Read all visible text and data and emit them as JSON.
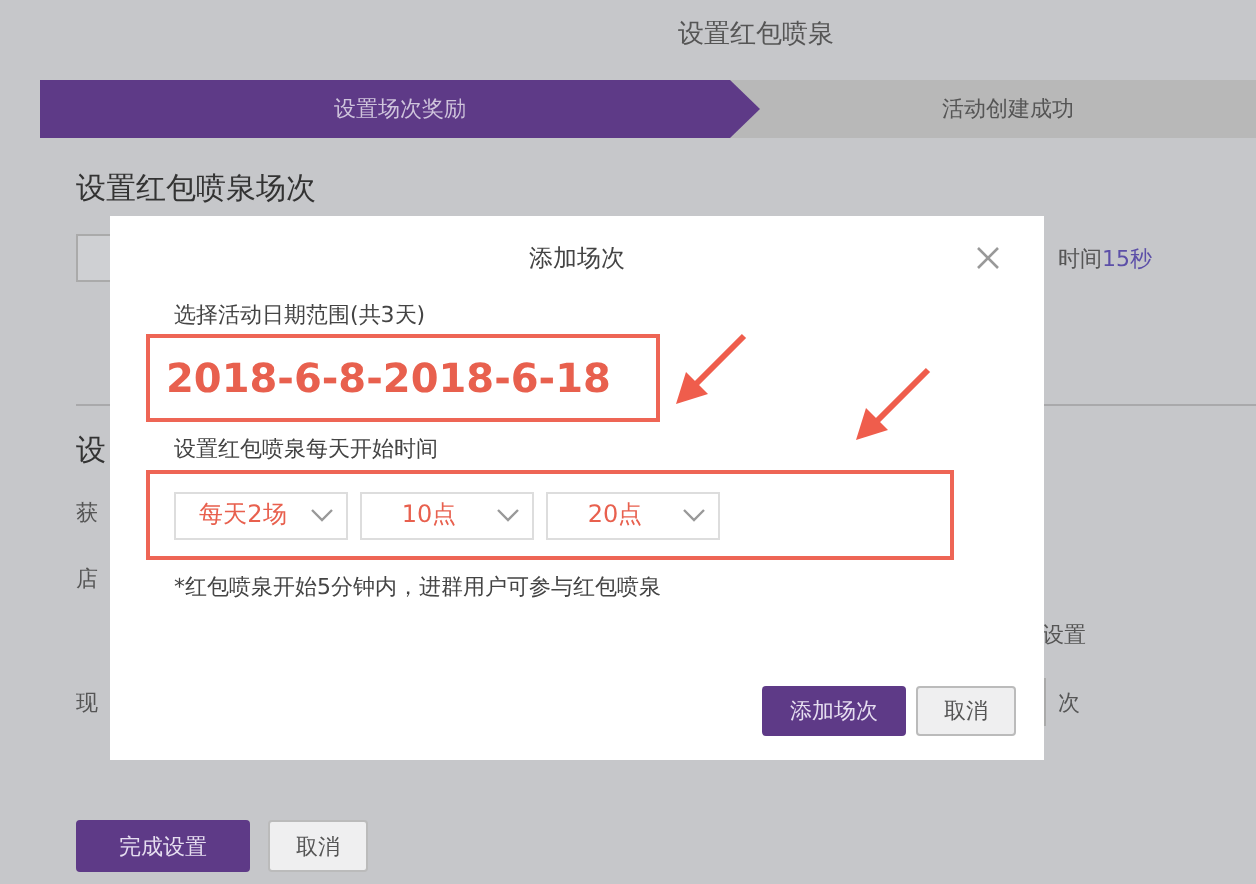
{
  "page_title": "设置红包喷泉",
  "steps": [
    {
      "label": "设置场次奖励",
      "selected": true
    },
    {
      "label": "活动创建成功",
      "selected": false
    }
  ],
  "section_title": "设置红包喷泉场次",
  "left_fragments": [
    "设",
    "获",
    "店",
    "现"
  ],
  "duration_label": "时间",
  "duration_value": "15秒",
  "setting_label": "设置",
  "times_unit": "次",
  "modal": {
    "title": "添加场次",
    "date_label": "选择活动日期范围(共3天)",
    "date_range": "2018-6-8-2018-6-18",
    "time_label": "设置红包喷泉每天开始时间",
    "selects": [
      "每天2场",
      "10点",
      "20点"
    ],
    "note": "*红包喷泉开始5分钟内，进群用户可参与红包喷泉",
    "buttons": [
      {
        "label": "添加场次",
        "kind": "primary"
      },
      {
        "label": "取消",
        "kind": "secondary"
      }
    ]
  },
  "footer_buttons": [
    {
      "label": "完成设置",
      "kind": "primary"
    },
    {
      "label": "取消",
      "kind": "secondary"
    }
  ]
}
